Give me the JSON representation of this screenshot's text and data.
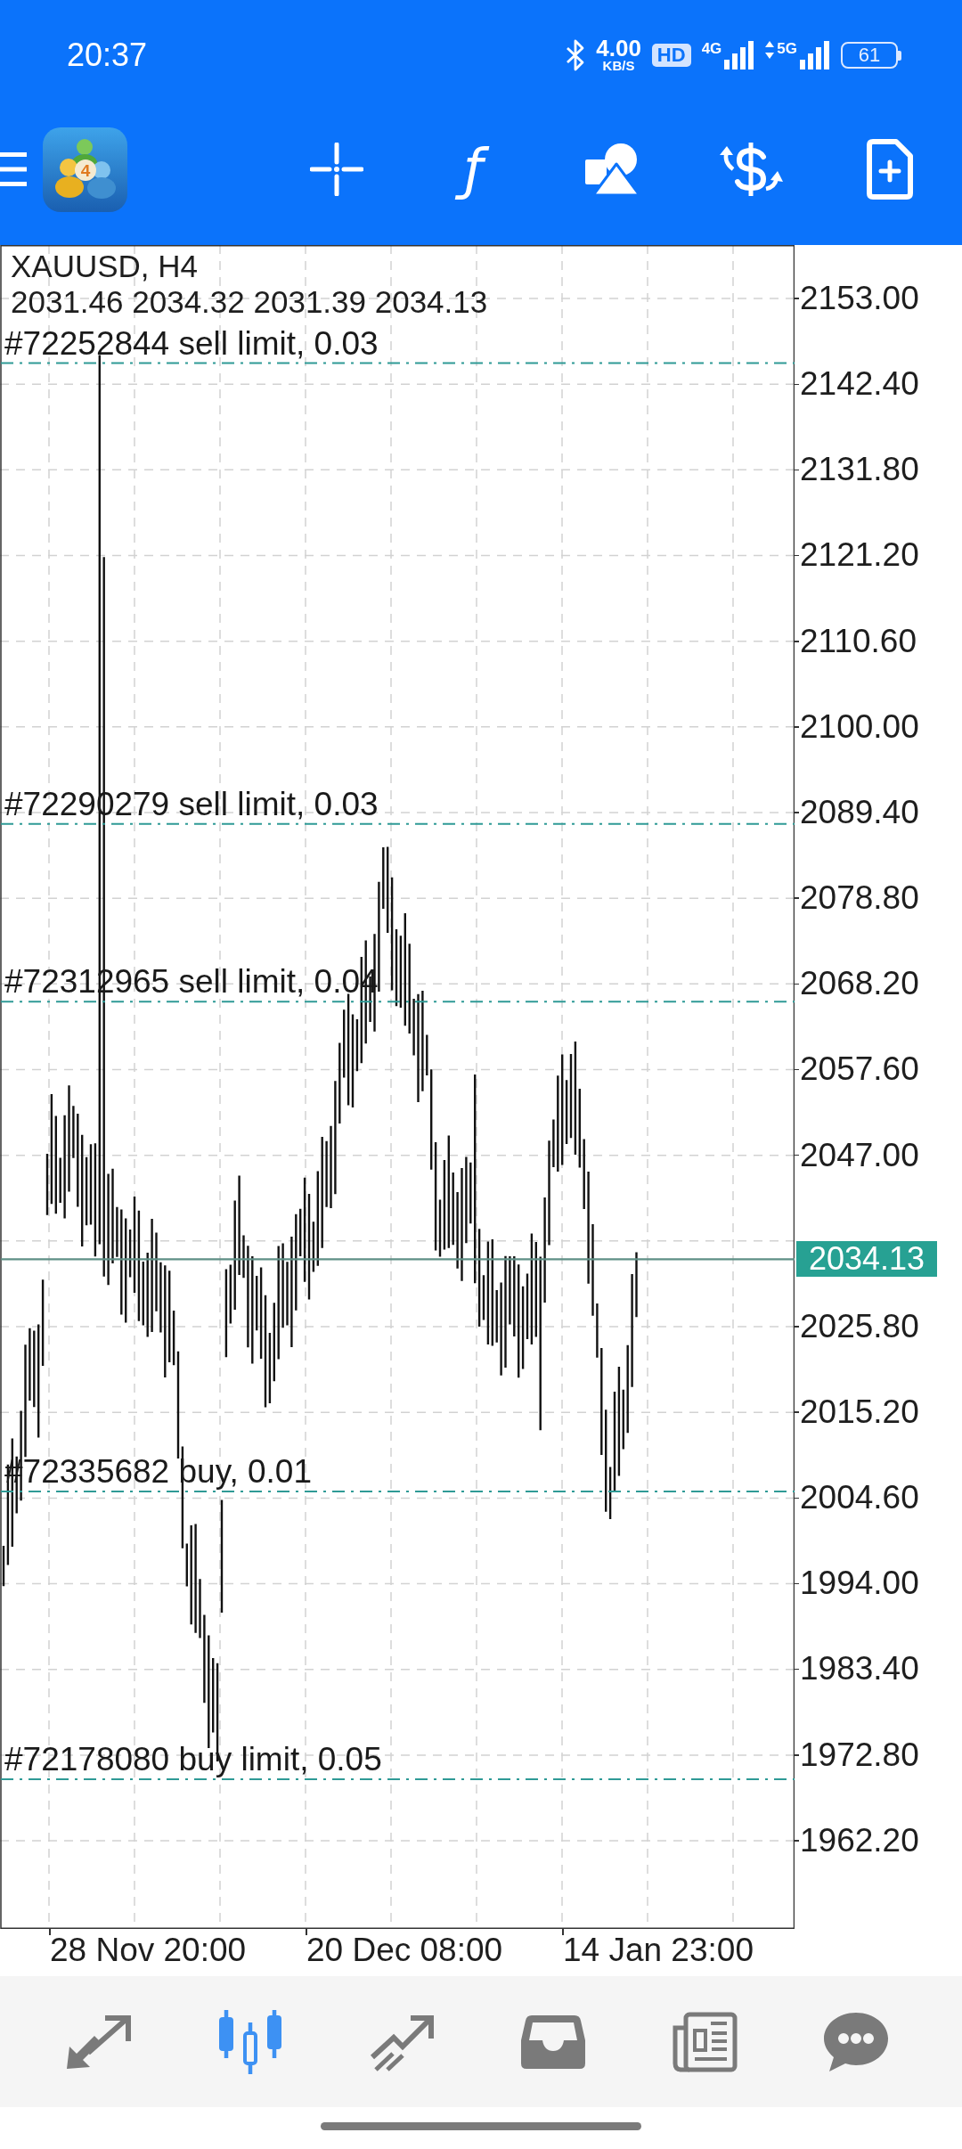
{
  "status_bar": {
    "time": "20:37",
    "net_speed": "4.00",
    "net_unit": "KB/S",
    "hd": "HD",
    "signal_1": "4G",
    "signal_2": "5G",
    "battery": "61"
  },
  "toolbar": {
    "logo_badge": "4",
    "tools": [
      {
        "kind": "crosshair"
      },
      {
        "kind": "function",
        "symbol": "ƒ"
      },
      {
        "kind": "objects"
      },
      {
        "kind": "trade"
      },
      {
        "kind": "new-order"
      }
    ]
  },
  "chart": {
    "symbol": "XAUUSD, H4",
    "ohlc": "2031.46 2034.32 2031.39 2034.13",
    "price_labels": [
      "2153.00",
      "2142.40",
      "2131.80",
      "2121.20",
      "2110.60",
      "2100.00",
      "2089.40",
      "2078.80",
      "2068.20",
      "2057.60",
      "2047.00",
      "2025.80",
      "2015.20",
      "2004.60",
      "1994.00",
      "1983.40",
      "1972.80",
      "1962.20"
    ],
    "current_price": "2034.13",
    "orders": [
      {
        "label": "#72252844 sell limit, 0.03"
      },
      {
        "label": "#72290279 sell limit, 0.03"
      },
      {
        "label": "#72312965 sell limit, 0.04"
      },
      {
        "label": "#72335682 buy, 0.01"
      },
      {
        "label": "#72178080 buy limit, 0.05"
      }
    ],
    "time_labels": [
      "28 Nov 20:00",
      "20 Dec 08:00",
      "14 Jan 23:00"
    ]
  },
  "bottom_nav": [
    {
      "kind": "quotes",
      "selected": false
    },
    {
      "kind": "chart",
      "selected": true
    },
    {
      "kind": "trade",
      "selected": false
    },
    {
      "kind": "history",
      "selected": false
    },
    {
      "kind": "news",
      "selected": false
    },
    {
      "kind": "messages",
      "selected": false
    }
  ]
}
